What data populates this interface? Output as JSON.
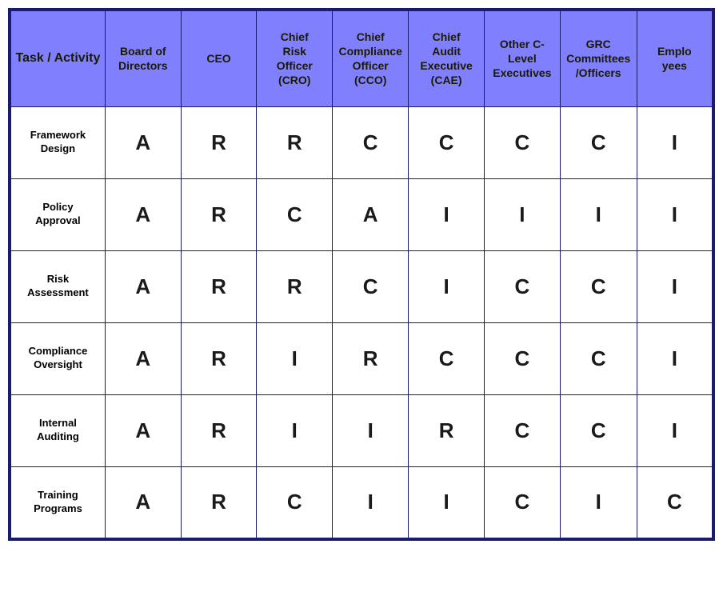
{
  "header": {
    "task_label": "Task / Activity",
    "columns": [
      {
        "id": "board",
        "label": "Board of Directors"
      },
      {
        "id": "ceo",
        "label": "CEO"
      },
      {
        "id": "cro",
        "label": "Chief Risk Officer (CRO)"
      },
      {
        "id": "cco",
        "label": "Chief Compliance Officer (CCO)"
      },
      {
        "id": "cae",
        "label": "Chief Audit Executive (CAE)"
      },
      {
        "id": "other",
        "label": "Other C-Level Executives"
      },
      {
        "id": "grc",
        "label": "GRC Committees /Officers"
      },
      {
        "id": "employees",
        "label": "Employees"
      }
    ]
  },
  "rows": [
    {
      "task": "Framework Design",
      "values": [
        "A",
        "R",
        "R",
        "C",
        "C",
        "C",
        "C",
        "I"
      ]
    },
    {
      "task": "Policy Approval",
      "values": [
        "A",
        "R",
        "C",
        "A",
        "I",
        "I",
        "I",
        "I"
      ]
    },
    {
      "task": "Risk Assessment",
      "values": [
        "A",
        "R",
        "R",
        "C",
        "I",
        "C",
        "C",
        "I"
      ]
    },
    {
      "task": "Compliance Oversight",
      "values": [
        "A",
        "R",
        "I",
        "R",
        "C",
        "C",
        "C",
        "I"
      ]
    },
    {
      "task": "Internal Auditing",
      "values": [
        "A",
        "R",
        "I",
        "I",
        "R",
        "C",
        "C",
        "I"
      ]
    },
    {
      "task": "Training Programs",
      "values": [
        "A",
        "R",
        "C",
        "I",
        "I",
        "C",
        "I",
        "C"
      ]
    }
  ]
}
